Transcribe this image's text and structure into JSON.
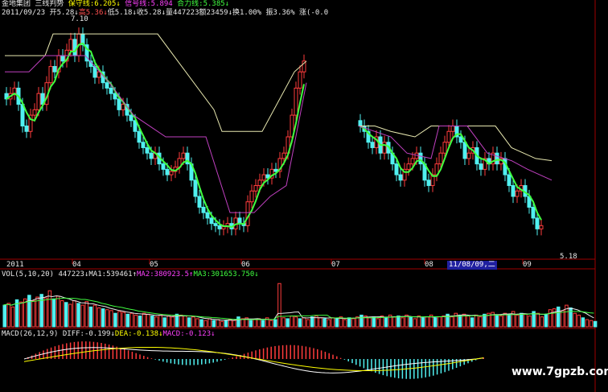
{
  "header": {
    "line1": [
      {
        "t": "金地集团",
        "c": "w"
      },
      {
        "t": "  三线判势 ",
        "c": "w"
      },
      {
        "t": "保守线:6.205↓",
        "c": "y"
      },
      {
        "t": "  信号线:5.894",
        "c": "m"
      },
      {
        "t": "  合力线:5.385↓",
        "c": "g"
      }
    ],
    "line2": [
      {
        "t": "2011/09/23",
        "c": "w"
      },
      {
        "t": " 开5.28↓",
        "c": "w"
      },
      {
        "t": "高5.36↓",
        "c": "r"
      },
      {
        "t": "低5.18↓",
        "c": "w"
      },
      {
        "t": "收5.28↓",
        "c": "w"
      },
      {
        "t": "量447223",
        "c": "w"
      },
      {
        "t": "额23459",
        "c": "w"
      },
      {
        "t": "↓换1.00%",
        "c": "w"
      },
      {
        "t": " 振3.36%",
        "c": "w"
      },
      {
        "t": " 涨(-0.0",
        "c": "w"
      }
    ]
  },
  "price_labels": {
    "high": "7.10",
    "low": "5.18"
  },
  "x_axis": {
    "labels": [
      "2011",
      "04",
      "05",
      "06",
      "07",
      "08",
      "09"
    ],
    "highlight": "11/08/09,二"
  },
  "volume_header": [
    {
      "t": "VOL(5,10,20)",
      "c": "w"
    },
    {
      "t": " 447223↓",
      "c": "w"
    },
    {
      "t": "MA1:539461↑",
      "c": "w"
    },
    {
      "t": "MA2:380923.5↑",
      "c": "m"
    },
    {
      "t": "MA3:301653.750↓",
      "c": "g"
    }
  ],
  "macd_header": [
    {
      "t": "MACD(26,12,9)",
      "c": "w"
    },
    {
      "t": " DIFF:-0.199↓",
      "c": "w"
    },
    {
      "t": "DEA:-0.138↓",
      "c": "y"
    },
    {
      "t": "MACD:-0.123↓",
      "c": "m"
    }
  ],
  "watermark": "www.7gpzb.com",
  "colors": {
    "up": "#ff3c3c",
    "down": "#50f0f0",
    "conservative": "#e8e8b0",
    "signal": "#c040c0",
    "resultant": "#40ff40",
    "grid": "#a00000"
  },
  "chart_data": {
    "type": "candlestick",
    "ylim": [
      5.0,
      7.2
    ],
    "segments": [
      {
        "start": 0,
        "closes": [
          6.45,
          6.5,
          6.55,
          6.4,
          6.2,
          6.15,
          6.3,
          6.35,
          6.5,
          6.4,
          6.6,
          6.75,
          6.7,
          6.85,
          6.8,
          6.9,
          7.0,
          6.85,
          7.05,
          6.95,
          6.8,
          6.75,
          6.65,
          6.7,
          6.6,
          6.55,
          6.5,
          6.45,
          6.35,
          6.4,
          6.3,
          6.25,
          6.15,
          6.05,
          6.0,
          5.95,
          5.9,
          5.95,
          5.85,
          5.8,
          5.75,
          5.78,
          5.82,
          5.9,
          5.95,
          5.85,
          5.7,
          5.55,
          5.45,
          5.4,
          5.35,
          5.3,
          5.28,
          5.25,
          5.27,
          5.3,
          5.25,
          5.35,
          5.3,
          5.28,
          5.5,
          5.6,
          5.65,
          5.7,
          5.75,
          5.72,
          5.8,
          5.78,
          5.9,
          5.95,
          6.1,
          6.3,
          6.55,
          6.7,
          6.8
        ]
      },
      {
        "start": 88,
        "closes": [
          6.2,
          6.15,
          6.05,
          6.0,
          6.1,
          5.95,
          6.05,
          5.95,
          5.85,
          5.75,
          5.7,
          5.8,
          5.85,
          5.9,
          5.95,
          5.85,
          5.7,
          5.65,
          5.75,
          5.85,
          5.95,
          6.05,
          6.15,
          6.2,
          6.1,
          6.05,
          5.9,
          5.95,
          6.0,
          5.85,
          5.8,
          5.9,
          5.85,
          5.95,
          5.85,
          5.9,
          5.75,
          5.65,
          5.55,
          5.6,
          5.65,
          5.55,
          5.45,
          5.35,
          5.25,
          5.28
        ]
      }
    ],
    "lines": {
      "conservative": [
        [
          0,
          6.85
        ],
        [
          10,
          6.85
        ],
        [
          12,
          7.05
        ],
        [
          38,
          7.05
        ],
        [
          44,
          6.75
        ],
        [
          52,
          6.35
        ],
        [
          54,
          6.15
        ],
        [
          64,
          6.15
        ],
        [
          72,
          6.7
        ],
        [
          75,
          6.8
        ],
        [
          88,
          6.2
        ],
        [
          92,
          6.2
        ],
        [
          96,
          6.15
        ],
        [
          102,
          6.1
        ],
        [
          106,
          6.2
        ],
        [
          122,
          6.2
        ],
        [
          126,
          6.0
        ],
        [
          132,
          5.9
        ],
        [
          136,
          5.88
        ]
      ],
      "signal": [
        [
          0,
          6.7
        ],
        [
          6,
          6.7
        ],
        [
          10,
          6.85
        ],
        [
          20,
          6.85
        ],
        [
          26,
          6.6
        ],
        [
          32,
          6.3
        ],
        [
          40,
          6.1
        ],
        [
          50,
          6.1
        ],
        [
          56,
          5.4
        ],
        [
          62,
          5.4
        ],
        [
          66,
          5.55
        ],
        [
          70,
          5.65
        ],
        [
          75,
          6.6
        ],
        [
          88,
          6.2
        ],
        [
          96,
          6.1
        ],
        [
          100,
          5.95
        ],
        [
          106,
          5.9
        ],
        [
          108,
          6.2
        ],
        [
          115,
          6.2
        ],
        [
          120,
          5.95
        ],
        [
          126,
          5.88
        ],
        [
          130,
          5.8
        ],
        [
          136,
          5.7
        ]
      ]
    },
    "volume": {
      "values_pct": [
        48,
        52,
        44,
        60,
        55,
        62,
        70,
        58,
        66,
        72,
        64,
        80,
        62,
        68,
        58,
        54,
        50,
        58,
        52,
        48,
        56,
        44,
        48,
        42,
        40,
        38,
        36,
        30,
        34,
        32,
        28,
        30,
        26,
        24,
        30,
        28,
        24,
        22,
        26,
        20,
        24,
        22,
        28,
        26,
        24,
        20,
        22,
        18,
        16,
        14,
        18,
        14,
        16,
        12,
        14,
        16,
        14,
        22,
        18,
        20,
        14,
        16,
        18,
        14,
        20,
        14,
        16,
        96,
        20,
        18,
        24,
        22,
        18,
        20,
        16,
        22,
        24,
        20,
        18,
        16,
        20,
        18,
        22,
        16,
        20,
        18,
        22,
        26,
        24,
        20,
        22,
        18,
        24,
        20,
        26,
        22,
        24,
        20,
        26,
        22,
        18,
        24,
        20,
        22,
        26,
        20,
        22,
        24,
        28,
        22,
        30,
        26,
        28,
        24,
        20,
        26,
        22,
        28,
        30,
        32,
        26,
        24,
        30,
        28,
        34,
        26,
        30,
        28,
        24,
        34,
        30,
        22,
        28,
        38,
        40,
        44,
        36,
        48,
        42,
        30,
        26,
        20,
        16,
        14,
        12
      ]
    },
    "macd": {
      "hist_range": [
        -1,
        1
      ]
    }
  }
}
